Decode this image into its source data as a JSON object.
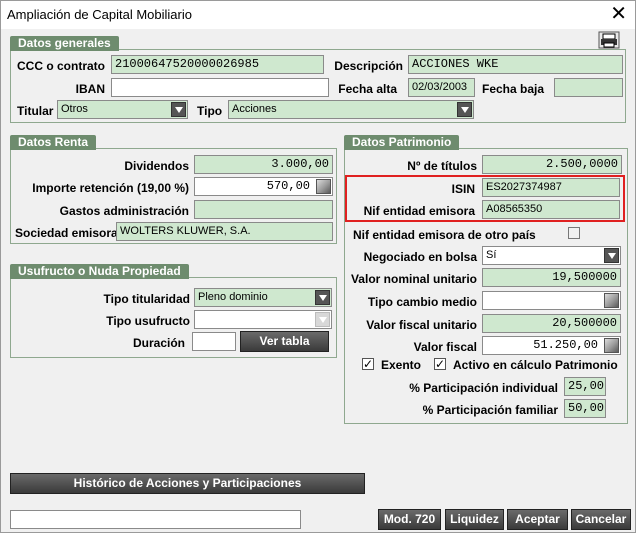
{
  "window": {
    "title": "Ampliación de Capital Mobiliario",
    "close_symbol": "✕"
  },
  "generales": {
    "title": "Datos generales",
    "ccc_label": "CCC o contrato",
    "ccc_value": "21000647520000026985",
    "descripcion_label": "Descripción",
    "descripcion_value": "ACCIONES WKE",
    "iban_label": "IBAN",
    "iban_value": "",
    "fecha_alta_label": "Fecha alta",
    "fecha_alta_value": "02/03/2003",
    "fecha_baja_label": "Fecha baja",
    "fecha_baja_value": "",
    "titular_label": "Titular",
    "titular_value": "Otros",
    "tipo_label": "Tipo",
    "tipo_value": "Acciones"
  },
  "renta": {
    "title": "Datos Renta",
    "dividendos_label": "Dividendos",
    "dividendos_value": "3.000,00",
    "retencion_label": "Importe retención (19,00 %)",
    "retencion_value": "570,00",
    "gastos_label": "Gastos administración",
    "gastos_value": "",
    "sociedad_label": "Sociedad emisora",
    "sociedad_value": "WOLTERS KLUWER, S.A."
  },
  "usufructo": {
    "title": "Usufructo o Nuda Propiedad",
    "tipo_titularidad_label": "Tipo titularidad",
    "tipo_titularidad_value": "Pleno dominio",
    "tipo_usufructo_label": "Tipo usufructo",
    "tipo_usufructo_value": "",
    "duracion_label": "Duración",
    "duracion_value": "",
    "ver_tabla_label": "Ver tabla"
  },
  "patrimonio": {
    "title": "Datos Patrimonio",
    "num_titulos_label": "Nº de títulos",
    "num_titulos_value": "2.500,0000",
    "isin_label": "ISIN",
    "isin_value": "ES2027374987",
    "nif_label": "Nif entidad emisora",
    "nif_value": "A08565350",
    "nif_otro_label": "Nif entidad emisora de otro país",
    "negociado_label": "Negociado en bolsa",
    "negociado_value": "Sí",
    "valor_nominal_label": "Valor nominal unitario",
    "valor_nominal_value": "19,500000",
    "tipo_cambio_label": "Tipo cambio medio",
    "tipo_cambio_value": "",
    "valor_fiscal_unit_label": "Valor fiscal unitario",
    "valor_fiscal_unit_value": "20,500000",
    "valor_fiscal_label": "Valor fiscal",
    "valor_fiscal_value": "51.250,00",
    "exento_label": "Exento",
    "activo_label": "Activo en cálculo Patrimonio",
    "check_mark": "✓",
    "part_individual_label": "% Participación individual",
    "part_individual_value": "25,00",
    "part_familiar_label": "% Participación familiar",
    "part_familiar_value": "50,00"
  },
  "footer": {
    "historico_label": "Histórico de Acciones y Participaciones",
    "status_value": "",
    "mod720_label": "Mod. 720",
    "liquidez_label": "Liquidez",
    "aceptar_label": "Aceptar",
    "cancelar_label": "Cancelar"
  }
}
